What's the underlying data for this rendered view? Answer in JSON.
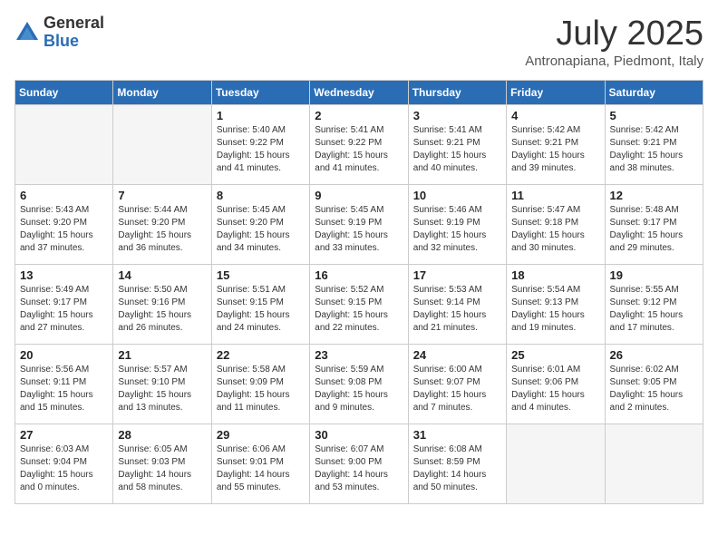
{
  "logo": {
    "general": "General",
    "blue": "Blue"
  },
  "header": {
    "month": "July 2025",
    "location": "Antronapiana, Piedmont, Italy"
  },
  "weekdays": [
    "Sunday",
    "Monday",
    "Tuesday",
    "Wednesday",
    "Thursday",
    "Friday",
    "Saturday"
  ],
  "weeks": [
    [
      {
        "day": "",
        "info": ""
      },
      {
        "day": "",
        "info": ""
      },
      {
        "day": "1",
        "info": "Sunrise: 5:40 AM\nSunset: 9:22 PM\nDaylight: 15 hours\nand 41 minutes."
      },
      {
        "day": "2",
        "info": "Sunrise: 5:41 AM\nSunset: 9:22 PM\nDaylight: 15 hours\nand 41 minutes."
      },
      {
        "day": "3",
        "info": "Sunrise: 5:41 AM\nSunset: 9:21 PM\nDaylight: 15 hours\nand 40 minutes."
      },
      {
        "day": "4",
        "info": "Sunrise: 5:42 AM\nSunset: 9:21 PM\nDaylight: 15 hours\nand 39 minutes."
      },
      {
        "day": "5",
        "info": "Sunrise: 5:42 AM\nSunset: 9:21 PM\nDaylight: 15 hours\nand 38 minutes."
      }
    ],
    [
      {
        "day": "6",
        "info": "Sunrise: 5:43 AM\nSunset: 9:20 PM\nDaylight: 15 hours\nand 37 minutes."
      },
      {
        "day": "7",
        "info": "Sunrise: 5:44 AM\nSunset: 9:20 PM\nDaylight: 15 hours\nand 36 minutes."
      },
      {
        "day": "8",
        "info": "Sunrise: 5:45 AM\nSunset: 9:20 PM\nDaylight: 15 hours\nand 34 minutes."
      },
      {
        "day": "9",
        "info": "Sunrise: 5:45 AM\nSunset: 9:19 PM\nDaylight: 15 hours\nand 33 minutes."
      },
      {
        "day": "10",
        "info": "Sunrise: 5:46 AM\nSunset: 9:19 PM\nDaylight: 15 hours\nand 32 minutes."
      },
      {
        "day": "11",
        "info": "Sunrise: 5:47 AM\nSunset: 9:18 PM\nDaylight: 15 hours\nand 30 minutes."
      },
      {
        "day": "12",
        "info": "Sunrise: 5:48 AM\nSunset: 9:17 PM\nDaylight: 15 hours\nand 29 minutes."
      }
    ],
    [
      {
        "day": "13",
        "info": "Sunrise: 5:49 AM\nSunset: 9:17 PM\nDaylight: 15 hours\nand 27 minutes."
      },
      {
        "day": "14",
        "info": "Sunrise: 5:50 AM\nSunset: 9:16 PM\nDaylight: 15 hours\nand 26 minutes."
      },
      {
        "day": "15",
        "info": "Sunrise: 5:51 AM\nSunset: 9:15 PM\nDaylight: 15 hours\nand 24 minutes."
      },
      {
        "day": "16",
        "info": "Sunrise: 5:52 AM\nSunset: 9:15 PM\nDaylight: 15 hours\nand 22 minutes."
      },
      {
        "day": "17",
        "info": "Sunrise: 5:53 AM\nSunset: 9:14 PM\nDaylight: 15 hours\nand 21 minutes."
      },
      {
        "day": "18",
        "info": "Sunrise: 5:54 AM\nSunset: 9:13 PM\nDaylight: 15 hours\nand 19 minutes."
      },
      {
        "day": "19",
        "info": "Sunrise: 5:55 AM\nSunset: 9:12 PM\nDaylight: 15 hours\nand 17 minutes."
      }
    ],
    [
      {
        "day": "20",
        "info": "Sunrise: 5:56 AM\nSunset: 9:11 PM\nDaylight: 15 hours\nand 15 minutes."
      },
      {
        "day": "21",
        "info": "Sunrise: 5:57 AM\nSunset: 9:10 PM\nDaylight: 15 hours\nand 13 minutes."
      },
      {
        "day": "22",
        "info": "Sunrise: 5:58 AM\nSunset: 9:09 PM\nDaylight: 15 hours\nand 11 minutes."
      },
      {
        "day": "23",
        "info": "Sunrise: 5:59 AM\nSunset: 9:08 PM\nDaylight: 15 hours\nand 9 minutes."
      },
      {
        "day": "24",
        "info": "Sunrise: 6:00 AM\nSunset: 9:07 PM\nDaylight: 15 hours\nand 7 minutes."
      },
      {
        "day": "25",
        "info": "Sunrise: 6:01 AM\nSunset: 9:06 PM\nDaylight: 15 hours\nand 4 minutes."
      },
      {
        "day": "26",
        "info": "Sunrise: 6:02 AM\nSunset: 9:05 PM\nDaylight: 15 hours\nand 2 minutes."
      }
    ],
    [
      {
        "day": "27",
        "info": "Sunrise: 6:03 AM\nSunset: 9:04 PM\nDaylight: 15 hours\nand 0 minutes."
      },
      {
        "day": "28",
        "info": "Sunrise: 6:05 AM\nSunset: 9:03 PM\nDaylight: 14 hours\nand 58 minutes."
      },
      {
        "day": "29",
        "info": "Sunrise: 6:06 AM\nSunset: 9:01 PM\nDaylight: 14 hours\nand 55 minutes."
      },
      {
        "day": "30",
        "info": "Sunrise: 6:07 AM\nSunset: 9:00 PM\nDaylight: 14 hours\nand 53 minutes."
      },
      {
        "day": "31",
        "info": "Sunrise: 6:08 AM\nSunset: 8:59 PM\nDaylight: 14 hours\nand 50 minutes."
      },
      {
        "day": "",
        "info": ""
      },
      {
        "day": "",
        "info": ""
      }
    ]
  ]
}
